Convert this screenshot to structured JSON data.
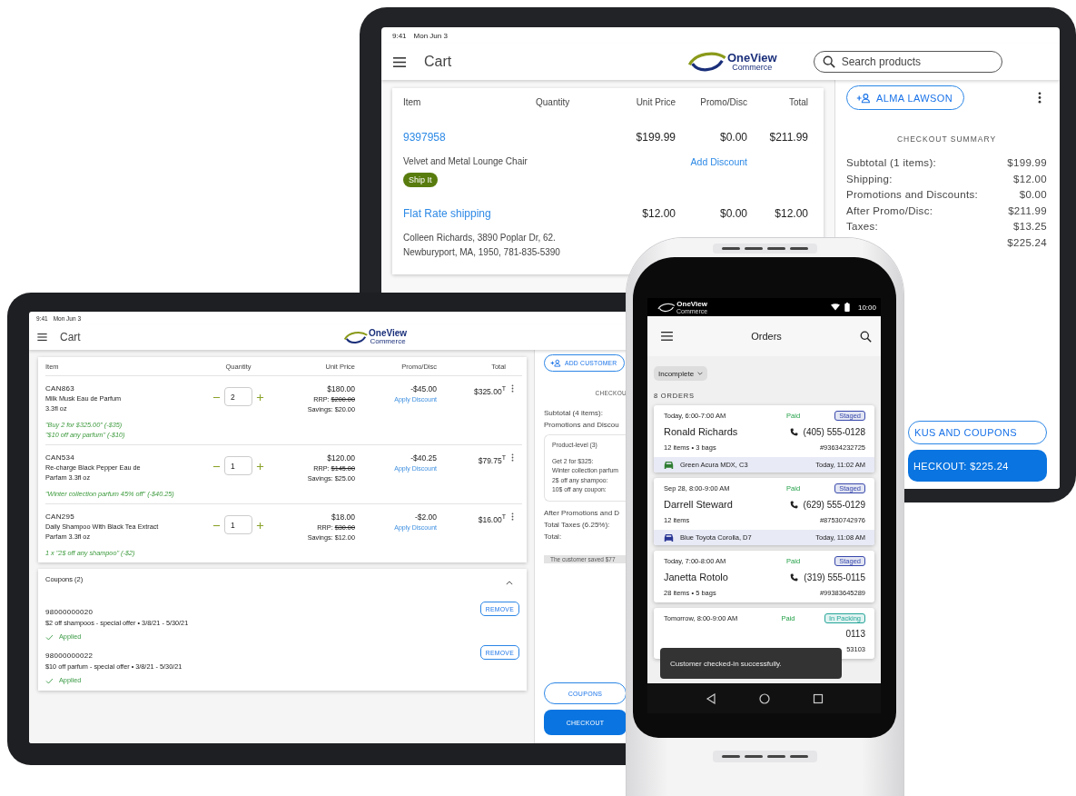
{
  "back_tablet": {
    "status_bar": {
      "time": "9:41",
      "date": "Mon Jun 3"
    },
    "app_bar": {
      "title": "Cart",
      "logo": {
        "name": "OneView",
        "tagline": "Commerce"
      },
      "search": {
        "placeholder": "Search products"
      }
    },
    "cart": {
      "columns": [
        "Item",
        "Quantity",
        "Unit Price",
        "Promo/Disc",
        "Total"
      ],
      "lines": [
        {
          "code": "9397958",
          "unit_price": "$199.99",
          "promo": "$0.00",
          "total": "$211.99",
          "description": [
            "Velvet and Metal Lounge Chair"
          ],
          "link": "Add Discount",
          "tag": "Ship It"
        },
        {
          "code": "Flat Rate shipping",
          "unit_price": "$12.00",
          "promo": "$0.00",
          "total": "$12.00",
          "description": [
            "Colleen Richards, 3890 Poplar Dr, 62.",
            "Newburyport, MA, 1950, 781-835-5390"
          ]
        }
      ]
    },
    "customer_button": "ALMA LAWSON",
    "summary": {
      "title": "CHECKOUT SUMMARY",
      "rows": [
        {
          "label": "Subtotal (1 items):",
          "value": "$199.99"
        },
        {
          "label": "Shipping:",
          "value": "$12.00"
        },
        {
          "label": "Promotions and Discounts:",
          "value": "$0.00"
        },
        {
          "label": "After Promo/Disc:",
          "value": "$211.99"
        },
        {
          "label": "Taxes:",
          "value": "$13.25"
        },
        {
          "value": "$225.24"
        }
      ]
    },
    "buttons": [
      {
        "kind": "outlined",
        "label": "KUS AND COUPONS"
      },
      {
        "kind": "filled",
        "label": "HECKOUT: $225.24"
      }
    ]
  },
  "front_tablet": {
    "status_bar": {
      "time": "9:41",
      "date": "Mon Jun 3"
    },
    "app_bar": {
      "title": "Cart",
      "logo": {
        "name": "OneView",
        "tagline": "Commerce"
      }
    },
    "cart": {
      "columns": [
        "Item",
        "Quantity",
        "Unit Price",
        "Promo/Disc",
        "Total"
      ],
      "rows": [
        {
          "code": "CAN863",
          "name": [
            "Milk Musk Eau de Parfum",
            "3.3fl oz"
          ],
          "quantity": "2",
          "price": "$180.00",
          "rrp_label": "RRP:",
          "rrp": "$200.00",
          "savings": "Savings: $20.00",
          "promo": "-$45.00",
          "link": "Apply Discount",
          "total": "$325.00$^{T}$",
          "promotions": [
            "\"Buy 2 for $325.00\" (-$35)",
            "\"$10 off any parfum\" (-$10)"
          ]
        },
        {
          "code": "CAN534",
          "name": [
            "Re-charge Black Pepper Eau de",
            "Parfam 3.3fl oz"
          ],
          "quantity": "1",
          "price": "$120.00",
          "rrp_label": "RRP:",
          "rrp": "$145.00",
          "savings": "Savings: $25.00",
          "promo": "-$40.25",
          "link": "Apply Discount",
          "total": "$79.75$^{T}$",
          "promotions": [
            "\"Winter collection parfum 45% off\" (-$40.25)"
          ]
        },
        {
          "code": "CAN295",
          "name": [
            "Daily Shampoo With Black Tea Extract",
            "Parfam 3.3fl oz"
          ],
          "quantity": "1",
          "price": "$18.00",
          "rrp_label": "RRP:",
          "rrp": "$30.00",
          "savings": "Savings: $12.00",
          "promo": "-$2.00",
          "link": "Apply Discount",
          "total": "$16.00$^{T}$",
          "promotions": [
            "1 x \"2$ off any shampoo\" (-$2)"
          ]
        }
      ]
    },
    "coupons": {
      "title": "Coupons (2)",
      "expanded": true,
      "items": [
        {
          "code": "98000000020",
          "description": "$2 off shampoos - special offer • 3/8/21 - 5/30/21",
          "button": "REMOVE",
          "applied": true,
          "status": "Applied"
        },
        {
          "code": "98000000022",
          "description": "$10 off parfum - special offer • 3/8/21 - 5/30/21",
          "button": "REMOVE",
          "applied": true,
          "status": "Applied"
        }
      ]
    },
    "customer_button": "ADD CUSTOMER",
    "summary": {
      "title": "CHECKOU",
      "rows": [
        "Subtotal (4 items):",
        "Promotions and Discou"
      ],
      "detail": {
        "title": "Product-level (3)",
        "lines": [
          "Get 2 for $325:",
          "Winter collection parfum",
          "2$ off any shampoo:",
          "10$ off any coupon:"
        ]
      },
      "rows_after": [
        "After Promotions and D",
        "Total Taxes (6.25%):",
        "Total:"
      ],
      "savings_note": "The customer saved $77"
    },
    "buttons": [
      {
        "kind": "outlined",
        "label": "COUPONS"
      },
      {
        "kind": "filled",
        "label": "CHECKOUT"
      }
    ]
  },
  "phone": {
    "status_bar": {
      "logo": {
        "name": "OneView",
        "tagline": "Commerce"
      },
      "time": "10:00"
    },
    "app_bar": {
      "title": "Orders"
    },
    "filter": {
      "label": "Incomplete"
    },
    "count": "8 ORDERS",
    "orders": [
      {
        "window": "Today, 6:00-7:00 AM",
        "payment": "Paid",
        "status": {
          "label": "Staged",
          "color": "#3949ab"
        },
        "name": "Ronald Richards",
        "phone": "(405) 555-0128",
        "items": "12 items • 3 bags",
        "order_no": "#93634232725",
        "vehicle": {
          "label": "Green Acura MDX, C3",
          "time": "Today, 11:02 AM",
          "color": "#2e7d32"
        }
      },
      {
        "window": "Sep 28, 8:00-9:00 AM",
        "payment": "Paid",
        "status": {
          "label": "Staged",
          "color": "#3949ab"
        },
        "name": "Darrell Steward",
        "phone": "(629) 555-0129",
        "items": "12 items",
        "order_no": "#87530742976",
        "vehicle": {
          "label": "Blue Toyota Corolla, D7",
          "time": "Today, 11:08 AM",
          "color": "#283593"
        }
      },
      {
        "window": "Today, 7:00-8:00 AM",
        "payment": "Paid",
        "status": {
          "label": "Staged",
          "color": "#3949ab"
        },
        "name": "Janetta Rotolo",
        "phone": "(319) 555-0115",
        "items": "28 items • 5 bags",
        "order_no": "#99383645289"
      },
      {
        "window": "Tomorrow, 8:00-9:00 AM",
        "payment": "Paid",
        "status": {
          "label": "In Packing",
          "color": "#26a69a"
        },
        "phone": "0113",
        "order_no": "53103"
      }
    ],
    "snackbar": "Customer checked-in successfully."
  }
}
